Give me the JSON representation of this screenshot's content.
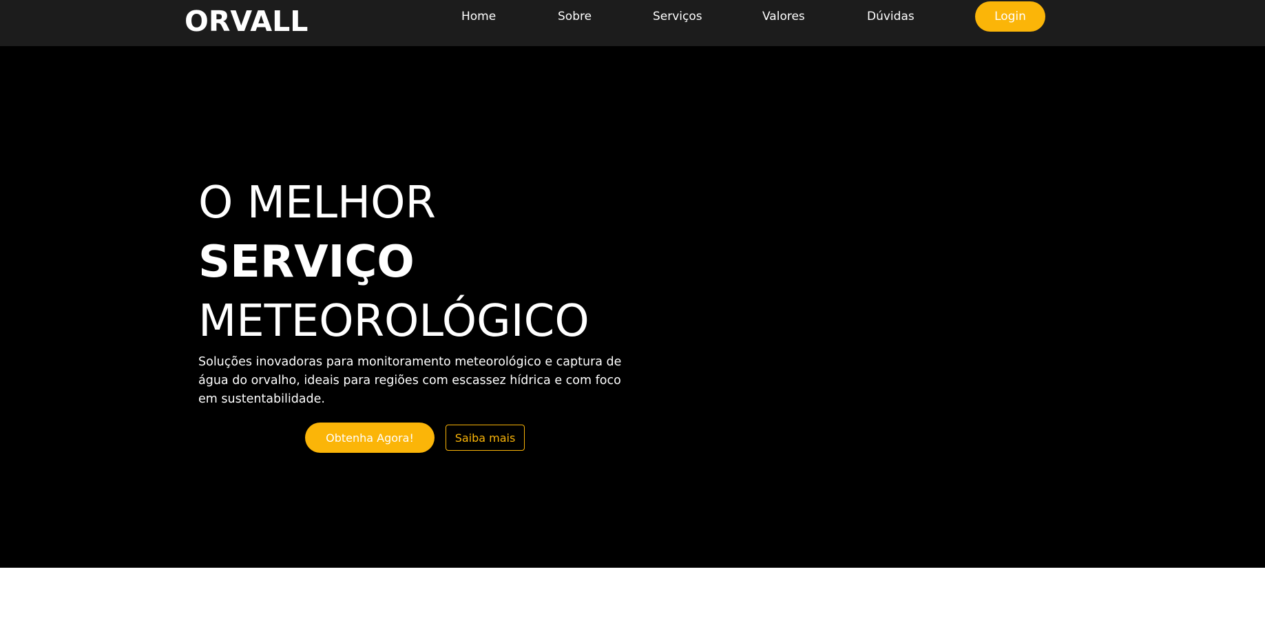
{
  "header": {
    "logo": "ORVALL",
    "nav": {
      "home": "Home",
      "sobre": "Sobre",
      "servicos": "Serviços",
      "valores": "Valores",
      "duvidas": "Dúvidas"
    },
    "login_label": "Login"
  },
  "hero": {
    "title_line1": "O MELHOR",
    "title_line2": "SERVIÇO",
    "title_line3": "METEOROLÓGICO",
    "description": "Soluções inovadoras para monitoramento meteorológico e captura de água do orvalho, ideais para regiões com escassez hídrica e com foco em sustentabilidade.",
    "primary_cta": "Obtenha Agora!",
    "secondary_cta": "Saiba mais"
  },
  "colors": {
    "accent": "#fbb508",
    "navbar_bg": "#1c1c1c",
    "hero_bg": "#000000",
    "page_bg": "#ffffff"
  }
}
